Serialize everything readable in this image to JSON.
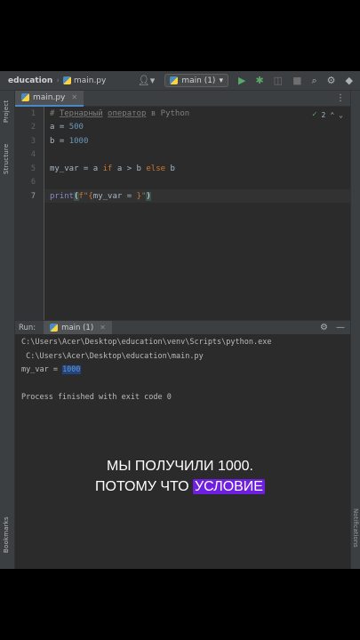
{
  "navbar": {
    "project": "education",
    "file": "main.py",
    "run_config": "main (1)"
  },
  "tabs": [
    {
      "label": "main.py"
    }
  ],
  "sidebar": {
    "project": "Project",
    "structure": "Structure",
    "bookmarks": "Bookmarks",
    "notifications": "Notifications"
  },
  "editor": {
    "line_numbers": [
      "1",
      "2",
      "3",
      "4",
      "5",
      "6",
      "7"
    ],
    "inspection_count": "2",
    "lines": {
      "l1_hash": "# ",
      "l1_w1": "Тернарный",
      "l1_w2": "оператор",
      "l1_rest": "в Python",
      "l2_a": "a = ",
      "l2_n": "500",
      "l3_a": "b = ",
      "l3_n": "1000",
      "l5_1": "my_var = a ",
      "l5_if": "if",
      "l5_2": " a > b ",
      "l5_else": "else",
      "l5_3": " b",
      "l7_print": "print",
      "l7_open": "(",
      "l7_f": "f\"",
      "l7_brace_open": "{",
      "l7_expr": "my_var = ",
      "l7_brace_close": "}",
      "l7_quote": "\"",
      "l7_close": ")"
    }
  },
  "run": {
    "label": "Run:",
    "tab": "main (1)",
    "output": {
      "cmd1": "C:\\Users\\Acer\\Desktop\\education\\venv\\Scripts\\python.exe",
      "cmd2": " C:\\Users\\Acer\\Desktop\\education\\main.py",
      "result_prefix": "my_var = ",
      "result_value": "1000",
      "finished": "Process finished with exit code 0"
    }
  },
  "subtitle": {
    "line1": "МЫ ПОЛУЧИЛИ 1000.",
    "line2_a": "ПОТОМУ ЧТО",
    "line2_b": "УСЛОВИЕ"
  },
  "colors": {
    "background": "#2b2b2b",
    "keyword": "#cc7832",
    "number": "#6897bb",
    "string": "#6a8759",
    "comment": "#808080",
    "subtitle_highlight": "#6f1fe0"
  }
}
